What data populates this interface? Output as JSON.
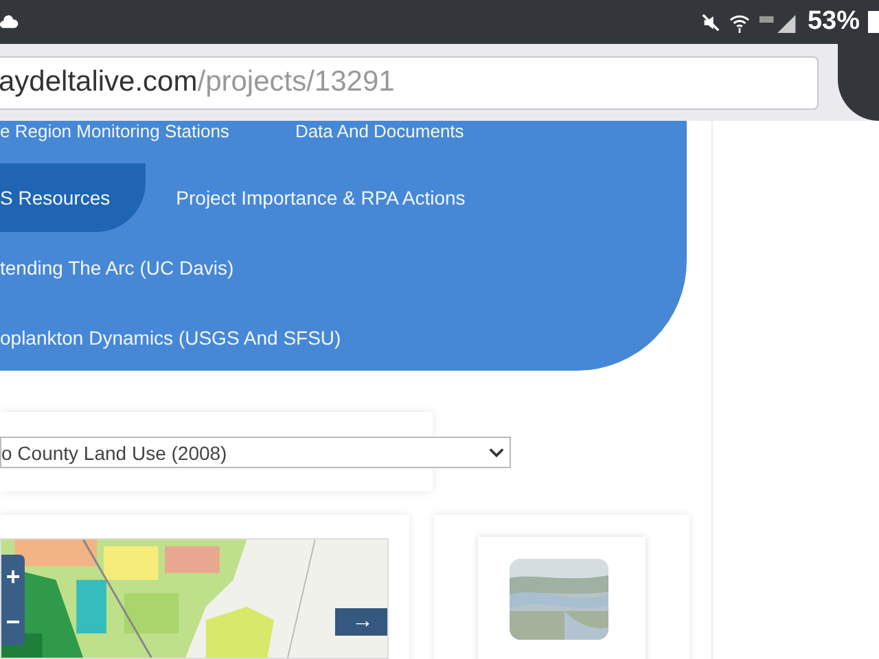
{
  "status_bar": {
    "battery": "53%"
  },
  "address_bar": {
    "domain": "aydeltalive.com",
    "path": "/projects/13291"
  },
  "top_links": [
    "e Region Monitoring Stations",
    "Data And Documents"
  ],
  "tabs": [
    [
      {
        "label": "S Resources",
        "selected": true
      },
      {
        "label": "Project Importance & RPA Actions",
        "selected": false
      }
    ],
    [
      {
        "label": "tending The Arc (UC Davis)",
        "selected": false
      }
    ],
    [
      {
        "label": "oplankton Dynamics (USGS And SFSU)",
        "selected": false
      }
    ]
  ],
  "layer_select": {
    "value": "o County Land Use (2008)"
  },
  "map": {
    "zoom_in": "+",
    "zoom_out": "−",
    "next": "→"
  },
  "thumbnail": {
    "kind": "picture"
  }
}
